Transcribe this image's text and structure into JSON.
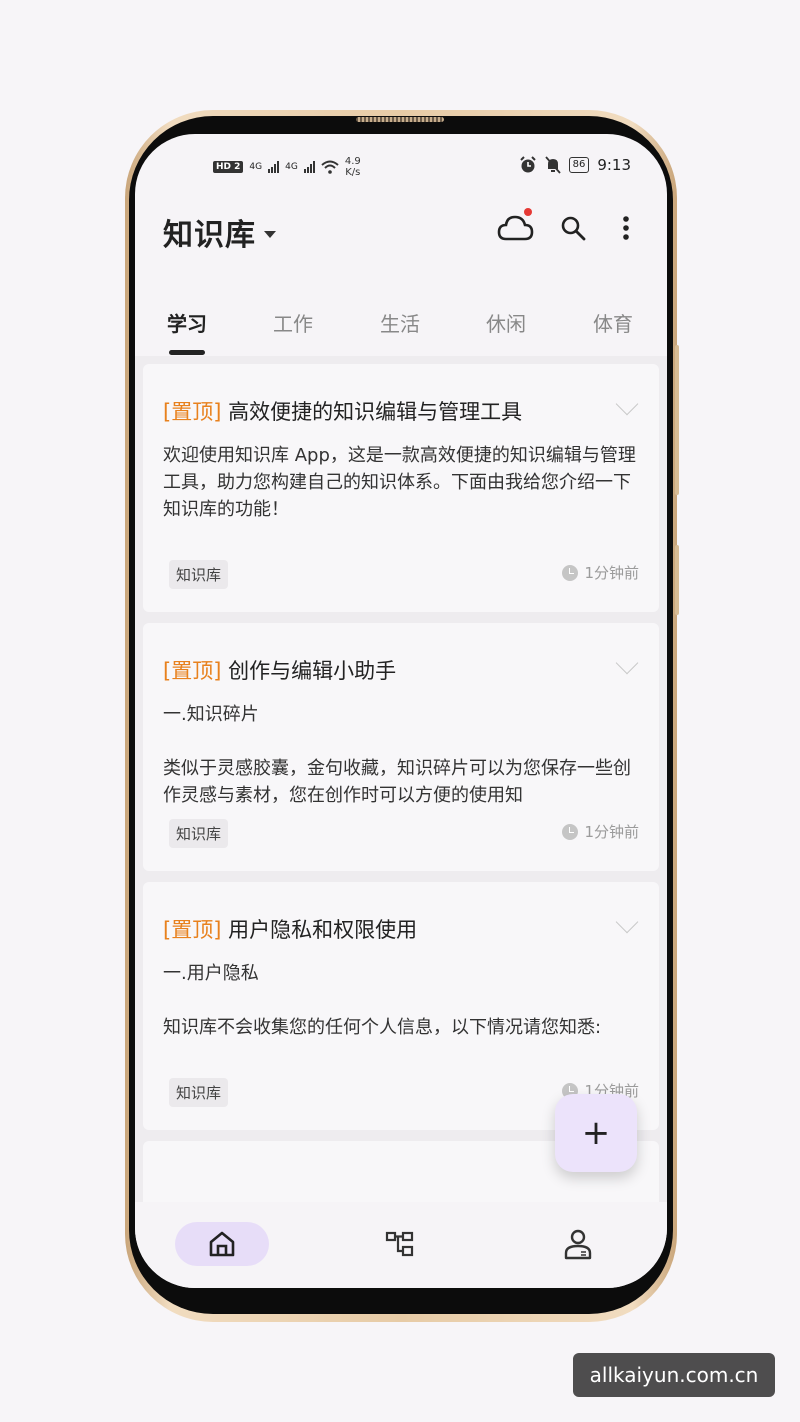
{
  "status_bar": {
    "hd_label": "HD",
    "hd_number": "2",
    "net1": "4G",
    "net2": "4G",
    "speed_value": "4.9",
    "speed_unit": "K/s",
    "battery": "86",
    "time": "9:13"
  },
  "header": {
    "title": "知识库",
    "has_sync_notification": true
  },
  "tabs": [
    {
      "label": "学习",
      "active": true
    },
    {
      "label": "工作",
      "active": false
    },
    {
      "label": "生活",
      "active": false
    },
    {
      "label": "休闲",
      "active": false
    },
    {
      "label": "体育",
      "active": false
    }
  ],
  "cards": [
    {
      "pin": "[置顶]",
      "title": "高效便捷的知识编辑与管理工具",
      "body": "欢迎使用知识库 App，这是一款高效便捷的知识编辑与管理工具，助力您构建自己的知识体系。下面由我给您介绍一下知识库的功能！",
      "tag": "知识库",
      "time": "1分钟前"
    },
    {
      "pin": "[置顶]",
      "title": "创作与编辑小助手",
      "body": "一.知识碎片\n\n类似于灵感胶囊，金句收藏，知识碎片可以为您保存一些创作灵感与素材，您在创作时可以方便的使用知",
      "tag": "知识库",
      "time": "1分钟前"
    },
    {
      "pin": "[置顶]",
      "title": "用户隐私和权限使用",
      "body": "一.用户隐私\n\n知识库不会收集您的任何个人信息，以下情况请您知悉:",
      "tag": "知识库",
      "time": "1分钟前"
    }
  ],
  "fab": {
    "label": "+"
  },
  "bottom_nav": [
    {
      "icon": "home-icon",
      "active": true
    },
    {
      "icon": "structure-icon",
      "active": false
    },
    {
      "icon": "user-icon",
      "active": false
    }
  ],
  "watermark": "allkaiyun.com.cn",
  "colors": {
    "pin_orange": "#e8811d",
    "accent_purple": "#e7ddf8",
    "notification_red": "#e53935"
  }
}
